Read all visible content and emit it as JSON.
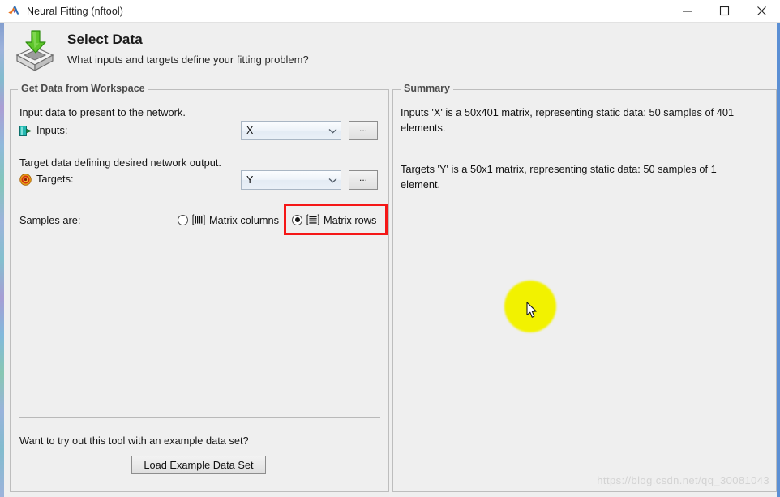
{
  "window": {
    "title": "Neural Fitting (nftool)",
    "app_icon": "matlab-logo-icon",
    "controls": {
      "minimize": "minimize-icon",
      "maximize": "maximize-icon",
      "close": "close-icon"
    }
  },
  "header": {
    "icon": "import-data-icon",
    "title": "Select Data",
    "subtitle": "What inputs and targets define your fitting problem?"
  },
  "workspace": {
    "legend": "Get Data from Workspace",
    "inputs": {
      "description": "Input data to present to the network.",
      "icon": "input-port-icon",
      "label": "Inputs:",
      "value": "X",
      "browse_label": "...",
      "options": [
        "X"
      ]
    },
    "targets": {
      "description": "Target data defining desired network output.",
      "icon": "target-bullseye-icon",
      "label": "Targets:",
      "value": "Y",
      "browse_label": "...",
      "options": [
        "Y"
      ]
    },
    "samples": {
      "label": "Samples are:",
      "options": [
        {
          "label": "Matrix columns",
          "icon": "matrix-columns-icon",
          "selected": false
        },
        {
          "label": "Matrix rows",
          "icon": "matrix-rows-icon",
          "selected": true
        }
      ],
      "highlight_color": "#f51717"
    },
    "example": {
      "question": "Want to try out this tool with an example data set?",
      "button_label": "Load Example Data Set"
    }
  },
  "summary": {
    "legend": "Summary",
    "inputs_text": "Inputs 'X' is a 50x401 matrix, representing static data: 50 samples of 401 elements.",
    "targets_text": "Targets 'Y' is a 50x1 matrix, representing static data: 50 samples of 1 element."
  },
  "overlay": {
    "click_highlight_color": "#f2f200",
    "cursor": "mouse-pointer-icon",
    "watermark": "https://blog.csdn.net/qq_30081043"
  }
}
